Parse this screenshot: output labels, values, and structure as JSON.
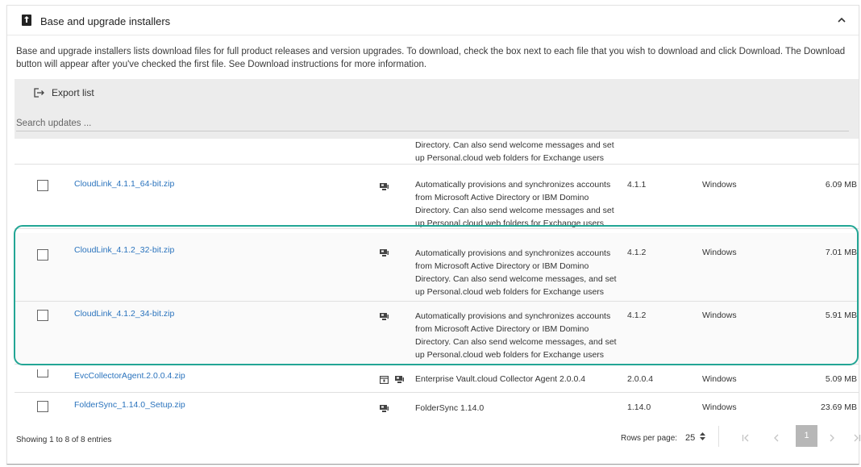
{
  "panel": {
    "title": "Base and upgrade installers",
    "description": "Base and upgrade installers lists download files for full product releases and version upgrades. To download, check the box next to each file that you wish to download and click Download. The Download button will appear after you've checked the first file. See Download instructions for more information."
  },
  "toolbar": {
    "export_label": "Export list",
    "search_placeholder": "Search updates ..."
  },
  "rows": [
    {
      "filename": "",
      "description": "Directory. Can also send welcome messages and set up Personal.cloud web folders for Exchange users",
      "version": "",
      "platform": "",
      "size": ""
    },
    {
      "filename": "CloudLink_4.1.1_64-bit.zip",
      "description": "Automatically provisions and synchronizes accounts from Microsoft Active Directory or IBM Domino Directory. Can also send welcome messages and set up Personal.cloud web folders for Exchange users",
      "version": "4.1.1",
      "platform": "Windows",
      "size": "6.09 MB"
    },
    {
      "filename": "CloudLink_4.1.2_32-bit.zip",
      "description": "Automatically provisions and synchronizes accounts from Microsoft Active Directory or IBM Domino Directory. Can also send welcome messages, and set up Personal.cloud web folders for Exchange users",
      "version": "4.1.2",
      "platform": "Windows",
      "size": "7.01 MB"
    },
    {
      "filename": "CloudLink_4.1.2_34-bit.zip",
      "description": "Automatically provisions and synchronizes accounts from Microsoft Active Directory or IBM Domino Directory. Can also send welcome messages, and set up Personal.cloud web folders for Exchange users",
      "version": "4.1.2",
      "platform": "Windows",
      "size": "5.91 MB"
    },
    {
      "filename": "EvcCollectorAgent.2.0.0.4.zip",
      "description": "Enterprise Vault.cloud Collector Agent 2.0.0.4",
      "version": "2.0.0.4",
      "platform": "Windows",
      "size": "5.09 MB"
    },
    {
      "filename": "FolderSync_1.14.0_Setup.zip",
      "description": "FolderSync 1.14.0",
      "version": "1.14.0",
      "platform": "Windows",
      "size": "23.69 MB"
    }
  ],
  "footer": {
    "entries_info": "Showing 1 to 8 of 8 entries",
    "rows_per_page_label": "Rows per page:",
    "rows_per_page_value": "25",
    "current_page": "1"
  },
  "colors": {
    "link": "#2a73bd",
    "highlight": "#23a695",
    "toolbar_bg": "#ececec"
  }
}
